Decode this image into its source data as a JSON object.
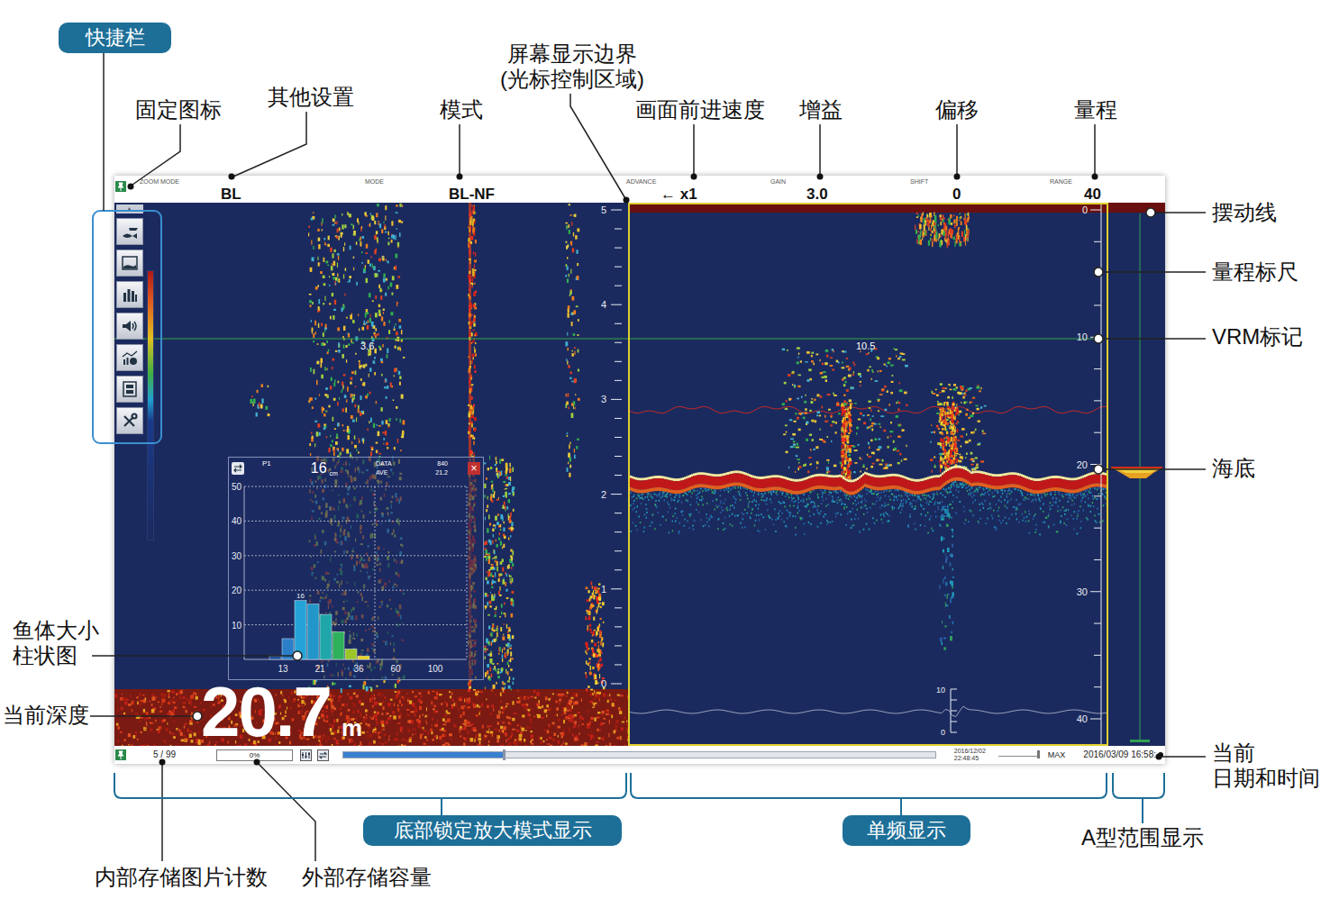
{
  "badges": [
    "快捷栏",
    "底部锁定放大模式显示",
    "单频显示"
  ],
  "callouts": [
    {
      "lines": [
        "固定图标"
      ]
    },
    {
      "lines": [
        "其他设置"
      ]
    },
    {
      "lines": [
        "模式"
      ]
    },
    {
      "lines": [
        "屏幕显示边界",
        "(光标控制区域)"
      ]
    },
    {
      "lines": [
        "画面前进速度"
      ]
    },
    {
      "lines": [
        "增益"
      ]
    },
    {
      "lines": [
        "偏移"
      ]
    },
    {
      "lines": [
        "量程"
      ]
    },
    {
      "lines": [
        "摆动线"
      ]
    },
    {
      "lines": [
        "量程标尺"
      ]
    },
    {
      "lines": [
        "VRM标记"
      ]
    },
    {
      "lines": [
        "海底"
      ]
    },
    {
      "lines": [
        "当前",
        "日期和时间"
      ]
    },
    {
      "lines": [
        "鱼体大小",
        "柱状图"
      ]
    },
    {
      "lines": [
        "当前深度"
      ]
    },
    {
      "lines": [
        "内部存储图片计数"
      ]
    },
    {
      "lines": [
        "外部存储容量"
      ]
    },
    {
      "lines": [
        "A型范围显示"
      ]
    }
  ],
  "top_bar": {
    "fields": [
      {
        "label": "ZOOM MODE",
        "value": "BL"
      },
      {
        "label": "MODE",
        "value": "BL-NF"
      },
      {
        "label": "ADVANCE",
        "value": "← x1"
      },
      {
        "label": "GAIN",
        "value": "3.0"
      },
      {
        "label": "SHIFT",
        "value": "0"
      },
      {
        "label": "RANGE",
        "value": "40"
      }
    ]
  },
  "quick_bar": {
    "scroll_arrow": "▲"
  },
  "zoom_panel": {
    "scale": [
      "5",
      "4",
      "3",
      "2",
      "1",
      "0"
    ],
    "vrm_reading": "3.6",
    "depth": "20.7",
    "depth_unit": "m"
  },
  "histogram": {
    "label": "P1",
    "size": "16",
    "unit": "cm",
    "data_label": "DATA",
    "data_value": "840",
    "ave_label": "AVE",
    "ave_value": "21.2",
    "close": "×",
    "peak_label": "16",
    "y_ticks": [
      "50",
      "40",
      "30",
      "20",
      "10"
    ],
    "x_ticks": [
      "13",
      "21",
      "36",
      "60",
      "100"
    ],
    "bars": [
      {
        "value": 1,
        "color": "#1f4f9a"
      },
      {
        "value": 6,
        "color": "#2a7fc8"
      },
      {
        "value": 17,
        "color": "#25a3d6"
      },
      {
        "value": 16,
        "color": "#2296c8"
      },
      {
        "value": 13,
        "color": "#1fa6a8"
      },
      {
        "value": 8,
        "color": "#2fb05a"
      },
      {
        "value": 3,
        "color": "#9cc52a"
      },
      {
        "value": 1,
        "color": "#e6d21e"
      }
    ]
  },
  "single_freq_panel": {
    "scale": [
      "0",
      "10",
      "20",
      "30",
      "40"
    ],
    "vrm_reading": "10.5",
    "inset_scale": [
      "10",
      "0"
    ]
  },
  "bottom_bar": {
    "image_count": "5 / 99",
    "storage": "0%",
    "playback_level": 0.27,
    "playback_date": "2016/12/02",
    "playback_time": "22:48:45",
    "speed_level": 0.95,
    "speed_label": "MAX",
    "clock": "2016/03/09 16:58:"
  }
}
